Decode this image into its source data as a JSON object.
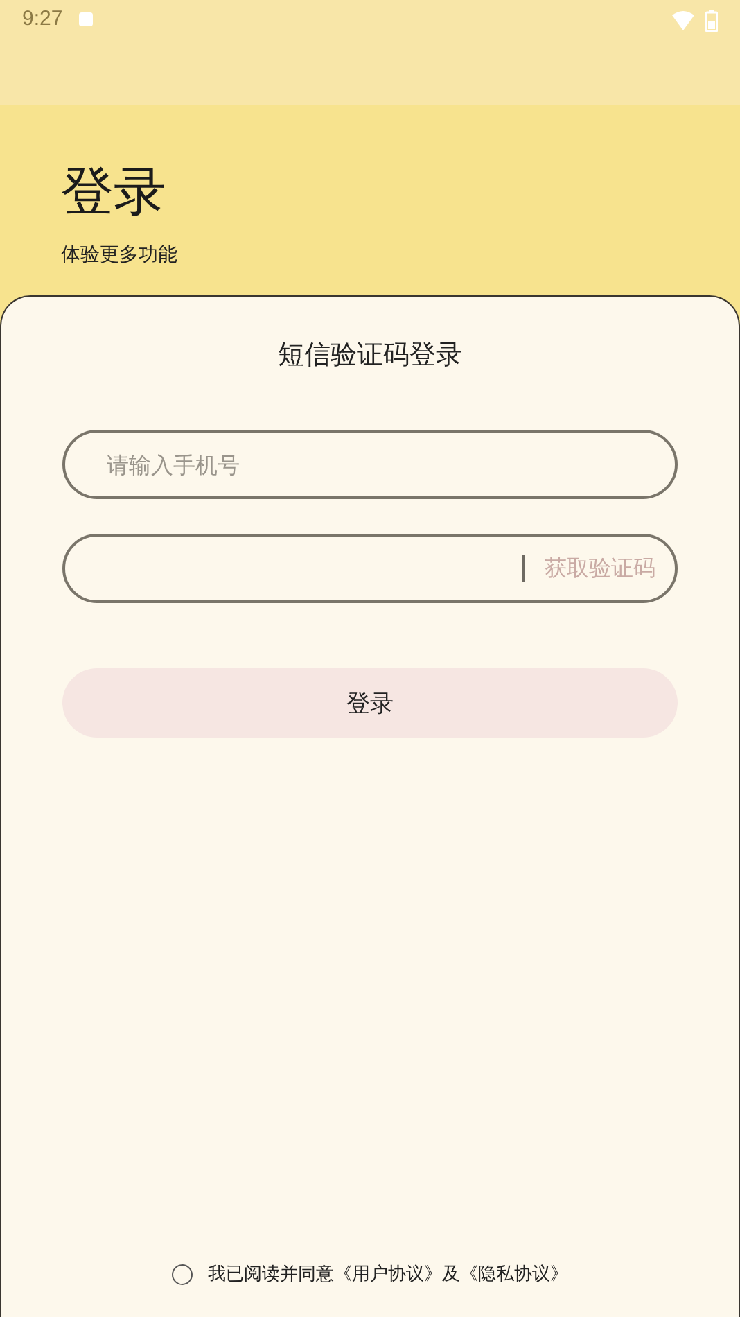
{
  "status_bar": {
    "time": "9:27"
  },
  "header": {
    "title": "登录",
    "subtitle": "体验更多功能"
  },
  "card": {
    "title": "短信验证码登录",
    "phone_field": {
      "placeholder": "请输入手机号"
    },
    "code_field": {
      "get_code_button": {
        "label": "获取验证码",
        "disabled": true
      }
    },
    "login_button": {
      "label": "登录",
      "disabled": true
    },
    "agreement": {
      "checked": false,
      "text": "我已阅读并同意《用户协议》及《隐私协议》"
    }
  }
}
